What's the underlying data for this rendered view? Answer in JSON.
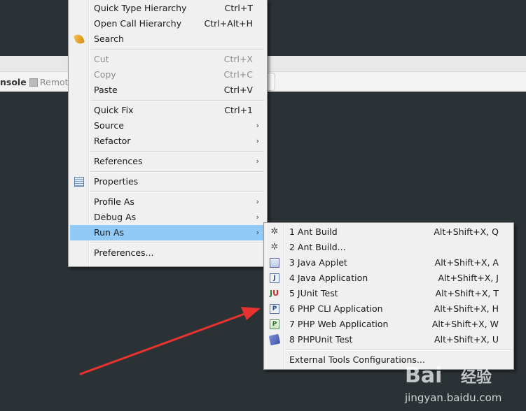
{
  "background": {
    "tab_console": "nsole",
    "tab_remote": "Remot"
  },
  "context_menu": {
    "items": [
      {
        "label": "Quick Type Hierarchy",
        "shortcut": "Ctrl+T"
      },
      {
        "label": "Open Call Hierarchy",
        "shortcut": "Ctrl+Alt+H"
      },
      {
        "label": "Search",
        "icon": "search-icon"
      },
      {
        "label": "Cut",
        "shortcut": "Ctrl+X",
        "disabled": true
      },
      {
        "label": "Copy",
        "shortcut": "Ctrl+C",
        "disabled": true
      },
      {
        "label": "Paste",
        "shortcut": "Ctrl+V"
      },
      {
        "label": "Quick Fix",
        "shortcut": "Ctrl+1"
      },
      {
        "label": "Source",
        "submenu": true
      },
      {
        "label": "Refactor",
        "submenu": true
      },
      {
        "label": "References",
        "submenu": true
      },
      {
        "label": "Properties",
        "icon": "properties-icon"
      },
      {
        "label": "Profile As",
        "submenu": true
      },
      {
        "label": "Debug As",
        "submenu": true
      },
      {
        "label": "Run As",
        "submenu": true,
        "highlighted": true
      },
      {
        "label": "Preferences..."
      }
    ],
    "submenu_arrow": "›"
  },
  "run_as_submenu": {
    "items": [
      {
        "label": "1 Ant Build",
        "shortcut": "Alt+Shift+X, Q",
        "icon": "ant-build-icon"
      },
      {
        "label": "2 Ant Build...",
        "icon": "ant-build-icon"
      },
      {
        "label": "3 Java Applet",
        "shortcut": "Alt+Shift+X, A",
        "icon": "java-applet-icon"
      },
      {
        "label": "4 Java Application",
        "shortcut": "Alt+Shift+X, J",
        "icon": "java-application-icon"
      },
      {
        "label": "5 JUnit Test",
        "shortcut": "Alt+Shift+X, T",
        "icon": "junit-icon"
      },
      {
        "label": "6 PHP CLI Application",
        "shortcut": "Alt+Shift+X, H",
        "icon": "php-cli-icon"
      },
      {
        "label": "7 PHP Web Application",
        "shortcut": "Alt+Shift+X, W",
        "icon": "php-web-icon"
      },
      {
        "label": "8 PHPUnit Test",
        "shortcut": "Alt+Shift+X, U",
        "icon": "phpunit-icon"
      },
      {
        "label": "External Tools Configurations..."
      }
    ],
    "icon_glyphs": {
      "java_application": "J",
      "junit_j": "J",
      "junit_u": "U",
      "php_cli": "P",
      "php_web": "P",
      "ant": "✲"
    }
  },
  "annotation": {
    "arrow_color": "#e8322f"
  },
  "watermark": {
    "brand": "Bai",
    "brand2": "经验",
    "url": "jingyan.baidu.com"
  },
  "colors": {
    "highlight": "#91c9f7",
    "menu_bg": "#f0f0f0",
    "desktop_bg": "#2b3236"
  }
}
